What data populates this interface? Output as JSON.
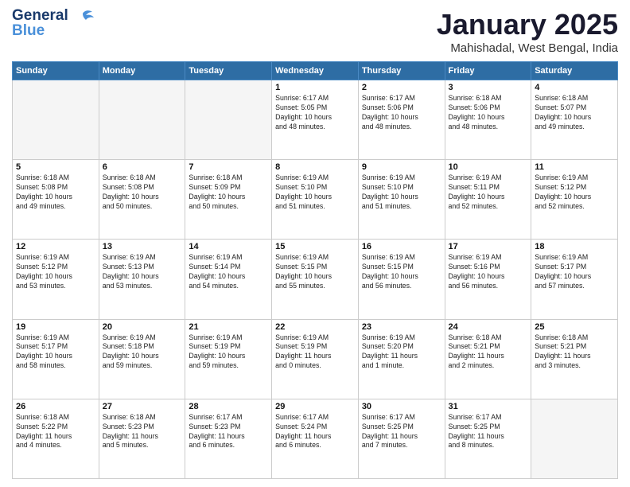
{
  "header": {
    "logo_line1": "General",
    "logo_line2": "Blue",
    "main_title": "January 2025",
    "subtitle": "Mahishadal, West Bengal, India"
  },
  "weekdays": [
    "Sunday",
    "Monday",
    "Tuesday",
    "Wednesday",
    "Thursday",
    "Friday",
    "Saturday"
  ],
  "weeks": [
    [
      {
        "day": "",
        "info": ""
      },
      {
        "day": "",
        "info": ""
      },
      {
        "day": "",
        "info": ""
      },
      {
        "day": "1",
        "info": "Sunrise: 6:17 AM\nSunset: 5:05 PM\nDaylight: 10 hours\nand 48 minutes."
      },
      {
        "day": "2",
        "info": "Sunrise: 6:17 AM\nSunset: 5:06 PM\nDaylight: 10 hours\nand 48 minutes."
      },
      {
        "day": "3",
        "info": "Sunrise: 6:18 AM\nSunset: 5:06 PM\nDaylight: 10 hours\nand 48 minutes."
      },
      {
        "day": "4",
        "info": "Sunrise: 6:18 AM\nSunset: 5:07 PM\nDaylight: 10 hours\nand 49 minutes."
      }
    ],
    [
      {
        "day": "5",
        "info": "Sunrise: 6:18 AM\nSunset: 5:08 PM\nDaylight: 10 hours\nand 49 minutes."
      },
      {
        "day": "6",
        "info": "Sunrise: 6:18 AM\nSunset: 5:08 PM\nDaylight: 10 hours\nand 50 minutes."
      },
      {
        "day": "7",
        "info": "Sunrise: 6:18 AM\nSunset: 5:09 PM\nDaylight: 10 hours\nand 50 minutes."
      },
      {
        "day": "8",
        "info": "Sunrise: 6:19 AM\nSunset: 5:10 PM\nDaylight: 10 hours\nand 51 minutes."
      },
      {
        "day": "9",
        "info": "Sunrise: 6:19 AM\nSunset: 5:10 PM\nDaylight: 10 hours\nand 51 minutes."
      },
      {
        "day": "10",
        "info": "Sunrise: 6:19 AM\nSunset: 5:11 PM\nDaylight: 10 hours\nand 52 minutes."
      },
      {
        "day": "11",
        "info": "Sunrise: 6:19 AM\nSunset: 5:12 PM\nDaylight: 10 hours\nand 52 minutes."
      }
    ],
    [
      {
        "day": "12",
        "info": "Sunrise: 6:19 AM\nSunset: 5:12 PM\nDaylight: 10 hours\nand 53 minutes."
      },
      {
        "day": "13",
        "info": "Sunrise: 6:19 AM\nSunset: 5:13 PM\nDaylight: 10 hours\nand 53 minutes."
      },
      {
        "day": "14",
        "info": "Sunrise: 6:19 AM\nSunset: 5:14 PM\nDaylight: 10 hours\nand 54 minutes."
      },
      {
        "day": "15",
        "info": "Sunrise: 6:19 AM\nSunset: 5:15 PM\nDaylight: 10 hours\nand 55 minutes."
      },
      {
        "day": "16",
        "info": "Sunrise: 6:19 AM\nSunset: 5:15 PM\nDaylight: 10 hours\nand 56 minutes."
      },
      {
        "day": "17",
        "info": "Sunrise: 6:19 AM\nSunset: 5:16 PM\nDaylight: 10 hours\nand 56 minutes."
      },
      {
        "day": "18",
        "info": "Sunrise: 6:19 AM\nSunset: 5:17 PM\nDaylight: 10 hours\nand 57 minutes."
      }
    ],
    [
      {
        "day": "19",
        "info": "Sunrise: 6:19 AM\nSunset: 5:17 PM\nDaylight: 10 hours\nand 58 minutes."
      },
      {
        "day": "20",
        "info": "Sunrise: 6:19 AM\nSunset: 5:18 PM\nDaylight: 10 hours\nand 59 minutes."
      },
      {
        "day": "21",
        "info": "Sunrise: 6:19 AM\nSunset: 5:19 PM\nDaylight: 10 hours\nand 59 minutes."
      },
      {
        "day": "22",
        "info": "Sunrise: 6:19 AM\nSunset: 5:19 PM\nDaylight: 11 hours\nand 0 minutes."
      },
      {
        "day": "23",
        "info": "Sunrise: 6:19 AM\nSunset: 5:20 PM\nDaylight: 11 hours\nand 1 minute."
      },
      {
        "day": "24",
        "info": "Sunrise: 6:18 AM\nSunset: 5:21 PM\nDaylight: 11 hours\nand 2 minutes."
      },
      {
        "day": "25",
        "info": "Sunrise: 6:18 AM\nSunset: 5:21 PM\nDaylight: 11 hours\nand 3 minutes."
      }
    ],
    [
      {
        "day": "26",
        "info": "Sunrise: 6:18 AM\nSunset: 5:22 PM\nDaylight: 11 hours\nand 4 minutes."
      },
      {
        "day": "27",
        "info": "Sunrise: 6:18 AM\nSunset: 5:23 PM\nDaylight: 11 hours\nand 5 minutes."
      },
      {
        "day": "28",
        "info": "Sunrise: 6:17 AM\nSunset: 5:23 PM\nDaylight: 11 hours\nand 6 minutes."
      },
      {
        "day": "29",
        "info": "Sunrise: 6:17 AM\nSunset: 5:24 PM\nDaylight: 11 hours\nand 6 minutes."
      },
      {
        "day": "30",
        "info": "Sunrise: 6:17 AM\nSunset: 5:25 PM\nDaylight: 11 hours\nand 7 minutes."
      },
      {
        "day": "31",
        "info": "Sunrise: 6:17 AM\nSunset: 5:25 PM\nDaylight: 11 hours\nand 8 minutes."
      },
      {
        "day": "",
        "info": ""
      }
    ]
  ]
}
